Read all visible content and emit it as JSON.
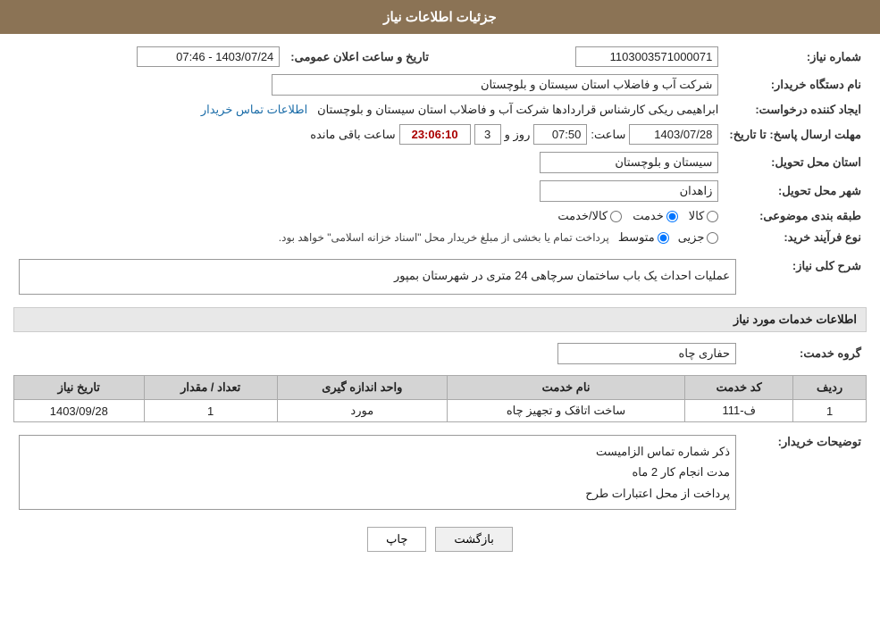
{
  "header": {
    "title": "جزئیات اطلاعات نیاز"
  },
  "fields": {
    "need_number_label": "شماره نیاز:",
    "need_number_value": "1103003571000071",
    "buyer_org_label": "نام دستگاه خریدار:",
    "buyer_org_value": "شرکت آب و فاضلاب استان سیستان و بلوچستان",
    "creator_label": "ایجاد کننده درخواست:",
    "creator_value": "ابراهیمی ریکی کارشناس قراردادها شرکت آب و فاضلاب استان سیستان و بلوچستان",
    "contact_link": "اطلاعات تماس خریدار",
    "announce_datetime_label": "تاریخ و ساعت اعلان عمومی:",
    "announce_datetime_value": "1403/07/24 - 07:46",
    "deadline_label": "مهلت ارسال پاسخ: تا تاریخ:",
    "deadline_date": "1403/07/28",
    "deadline_time_label": "ساعت:",
    "deadline_time": "07:50",
    "deadline_days_label": "روز و",
    "deadline_days": "3",
    "remain_label": "ساعت باقی مانده",
    "remain_time": "23:06:10",
    "province_label": "استان محل تحویل:",
    "province_value": "سیستان و بلوچستان",
    "city_label": "شهر محل تحویل:",
    "city_value": "زاهدان",
    "category_label": "طبقه بندی موضوعی:",
    "category_options": [
      "کالا",
      "خدمت",
      "کالا/خدمت"
    ],
    "category_selected": "خدمت",
    "purchase_type_label": "نوع فرآیند خرید:",
    "purchase_type_options": [
      "جزیی",
      "متوسط"
    ],
    "purchase_type_note": "پرداخت تمام یا بخشی از مبلغ خریدار محل \"اسناد خزانه اسلامی\" خواهد بود.",
    "purchase_type_selected": "متوسط",
    "need_desc_label": "شرح کلی نیاز:",
    "need_desc_value": "عملیات احداث یک باب ساختمان سرچاهی 24 متری در شهرستان بمپور",
    "services_title": "اطلاعات خدمات مورد نیاز",
    "service_group_label": "گروه خدمت:",
    "service_group_value": "حفاری چاه",
    "table_headers": [
      "ردیف",
      "کد خدمت",
      "نام خدمت",
      "واحد اندازه گیری",
      "تعداد / مقدار",
      "تاریخ نیاز"
    ],
    "table_rows": [
      {
        "row": "1",
        "code": "ف-111",
        "name": "ساخت اتاقک و تجهیز چاه",
        "unit": "مورد",
        "qty": "1",
        "date": "1403/09/28"
      }
    ],
    "buyer_desc_label": "توضیحات خریدار:",
    "buyer_desc_value": "ذکر شماره تماس الزامیست\nمدت انجام کار  2 ماه\nپرداخت از محل اعتبارات طرح",
    "btn_print": "چاپ",
    "btn_back": "بازگشت"
  },
  "colors": {
    "header_bg": "#8B7355",
    "table_header_bg": "#d4d4d4"
  }
}
